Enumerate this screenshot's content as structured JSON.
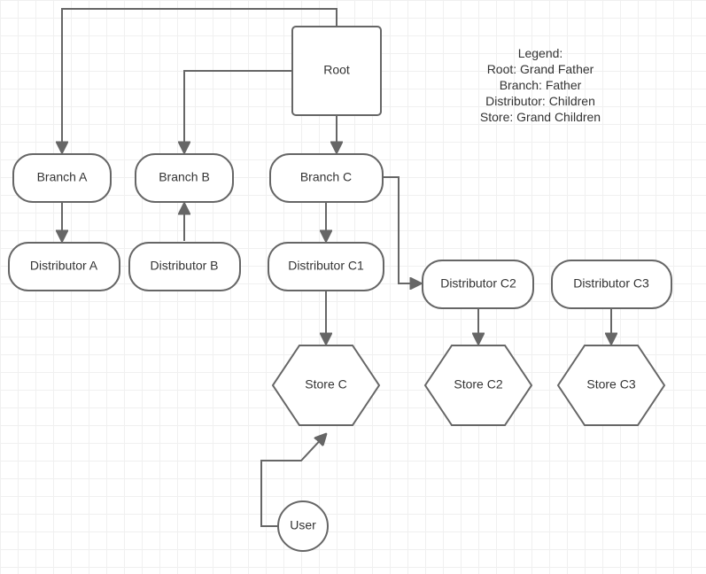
{
  "nodes": {
    "root": "Root",
    "branchA": "Branch A",
    "branchB": "Branch B",
    "branchC": "Branch C",
    "distA": "Distributor A",
    "distB": "Distributor B",
    "distC1": "Distributor C1",
    "distC2": "Distributor C2",
    "distC3": "Distributor  C3",
    "storeC": "Store C",
    "storeC2": "Store C2",
    "storeC3": "Store C3",
    "user": "User"
  },
  "legend": {
    "title": "Legend:",
    "line1": "Root: Grand Father",
    "line2": "Branch: Father",
    "line3": "Distributor: Children",
    "line4": "Store: Grand Children"
  }
}
